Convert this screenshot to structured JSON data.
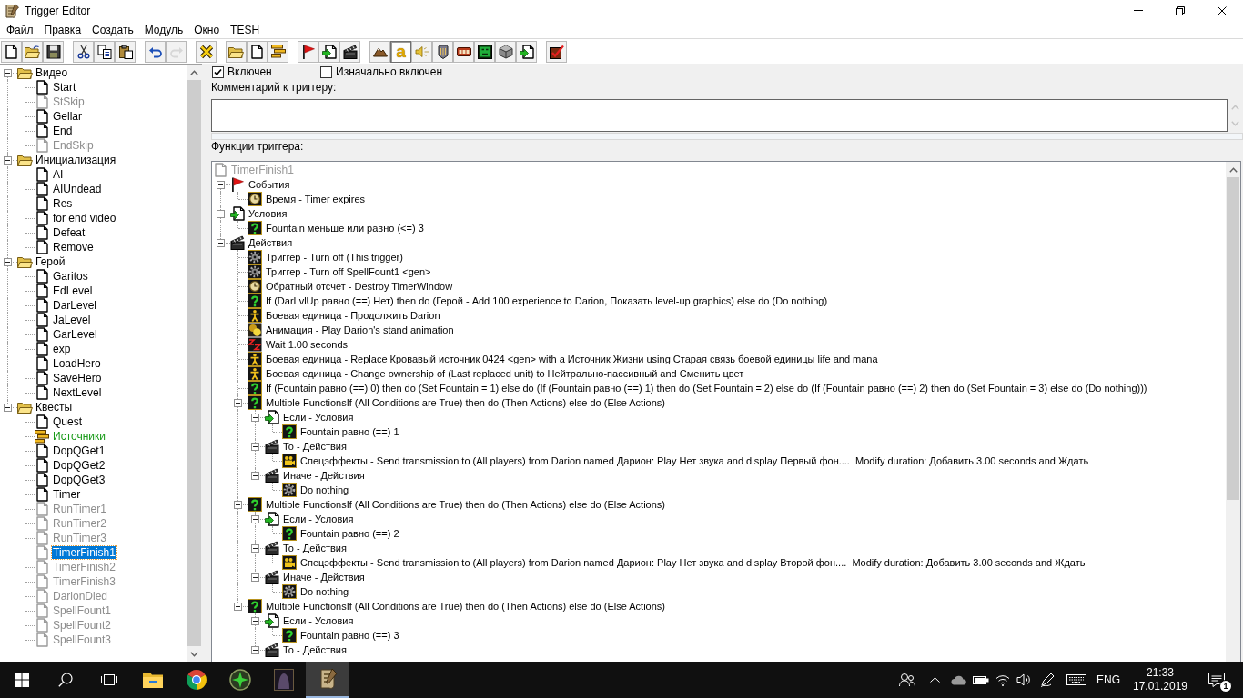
{
  "window": {
    "title": "Trigger Editor"
  },
  "menu": [
    "Файл",
    "Правка",
    "Создать",
    "Модуль",
    "Окно",
    "TESH"
  ],
  "toolbar": [
    {
      "buttons": [
        {
          "kind": "new",
          "disabled": false,
          "pressed": false
        },
        {
          "kind": "open",
          "disabled": false,
          "pressed": false
        },
        {
          "kind": "save",
          "disabled": false,
          "pressed": false
        }
      ]
    },
    {
      "buttons": [
        {
          "kind": "cut",
          "disabled": false,
          "pressed": false
        },
        {
          "kind": "copy",
          "disabled": false,
          "pressed": false
        },
        {
          "kind": "paste",
          "disabled": false,
          "pressed": false
        }
      ]
    },
    {
      "buttons": [
        {
          "kind": "undo",
          "disabled": false,
          "pressed": false
        },
        {
          "kind": "redo",
          "disabled": true,
          "pressed": false
        }
      ]
    },
    {
      "buttons": [
        {
          "kind": "cross",
          "disabled": false,
          "pressed": false
        }
      ]
    },
    {
      "buttons": [
        {
          "kind": "folder",
          "disabled": false,
          "pressed": false
        },
        {
          "kind": "document",
          "disabled": false,
          "pressed": false
        },
        {
          "kind": "lines",
          "disabled": false,
          "pressed": false
        }
      ]
    },
    {
      "buttons": [
        {
          "kind": "flag",
          "disabled": false,
          "pressed": false
        },
        {
          "kind": "arrow-document",
          "disabled": false,
          "pressed": false
        },
        {
          "kind": "clapperboard",
          "disabled": false,
          "pressed": false
        }
      ]
    },
    {
      "buttons": [
        {
          "kind": "mountain",
          "disabled": false,
          "pressed": false
        },
        {
          "kind": "letter",
          "label": "a",
          "disabled": false,
          "pressed": true
        },
        {
          "kind": "speaker",
          "disabled": false,
          "pressed": false
        },
        {
          "kind": "shield",
          "disabled": false,
          "pressed": false
        },
        {
          "kind": "panel",
          "disabled": false,
          "pressed": false
        },
        {
          "kind": "tile",
          "disabled": false,
          "pressed": false
        },
        {
          "kind": "cube",
          "disabled": false,
          "pressed": false
        },
        {
          "kind": "arrow-document",
          "disabled": false,
          "pressed": false
        }
      ]
    },
    {
      "buttons": [
        {
          "kind": "check",
          "disabled": false,
          "pressed": false
        }
      ]
    }
  ],
  "trigger_list": {
    "items": [
      {
        "label": "Видео",
        "kind": "folder",
        "expanded": true,
        "selected": false,
        "children": [
          {
            "label": "Start",
            "kind": "trigger",
            "enabled": true,
            "selected": false
          },
          {
            "label": "StSkip",
            "kind": "trigger",
            "enabled": false,
            "selected": false
          },
          {
            "label": "Gellar",
            "kind": "trigger",
            "enabled": true,
            "selected": false
          },
          {
            "label": "End",
            "kind": "trigger",
            "enabled": true,
            "selected": false
          },
          {
            "label": "EndSkip",
            "kind": "trigger",
            "enabled": false,
            "selected": false
          }
        ]
      },
      {
        "label": "Инициализация",
        "kind": "folder",
        "expanded": true,
        "selected": false,
        "children": [
          {
            "label": "AI",
            "kind": "trigger",
            "enabled": true,
            "selected": false
          },
          {
            "label": "AIUndead",
            "kind": "trigger",
            "enabled": true,
            "selected": false
          },
          {
            "label": "Res",
            "kind": "trigger",
            "enabled": true,
            "selected": false
          },
          {
            "label": "for end video",
            "kind": "trigger",
            "enabled": true,
            "selected": false
          },
          {
            "label": "Defeat",
            "kind": "trigger",
            "enabled": true,
            "selected": false
          },
          {
            "label": "Remove",
            "kind": "trigger",
            "enabled": true,
            "selected": false
          }
        ]
      },
      {
        "label": "Герой",
        "kind": "folder",
        "expanded": true,
        "selected": false,
        "children": [
          {
            "label": "Garitos",
            "kind": "trigger",
            "enabled": true,
            "selected": false
          },
          {
            "label": "EdLevel",
            "kind": "trigger",
            "enabled": true,
            "selected": false
          },
          {
            "label": "DarLevel",
            "kind": "trigger",
            "enabled": true,
            "selected": false
          },
          {
            "label": "JaLevel",
            "kind": "trigger",
            "enabled": true,
            "selected": false
          },
          {
            "label": "GarLevel",
            "kind": "trigger",
            "enabled": true,
            "selected": false
          },
          {
            "label": "exp",
            "kind": "trigger",
            "enabled": true,
            "selected": false
          },
          {
            "label": "LoadHero",
            "kind": "trigger",
            "enabled": true,
            "selected": false
          },
          {
            "label": "SaveHero",
            "kind": "trigger",
            "enabled": true,
            "selected": false
          },
          {
            "label": "NextLevel",
            "kind": "trigger",
            "enabled": true,
            "selected": false
          }
        ]
      },
      {
        "label": "Квесты",
        "kind": "folder",
        "expanded": true,
        "selected": false,
        "children": [
          {
            "label": "Quest",
            "kind": "trigger",
            "enabled": true,
            "selected": false
          },
          {
            "label": "Источники",
            "kind": "comment",
            "enabled": true,
            "selected": false
          },
          {
            "label": "DopQGet1",
            "kind": "trigger",
            "enabled": true,
            "selected": false
          },
          {
            "label": "DopQGet2",
            "kind": "trigger",
            "enabled": true,
            "selected": false
          },
          {
            "label": "DopQGet3",
            "kind": "trigger",
            "enabled": true,
            "selected": false
          },
          {
            "label": "Timer",
            "kind": "trigger",
            "enabled": true,
            "selected": false
          },
          {
            "label": "RunTimer1",
            "kind": "trigger",
            "enabled": false,
            "selected": false
          },
          {
            "label": "RunTimer2",
            "kind": "trigger",
            "enabled": false,
            "selected": false
          },
          {
            "label": "RunTimer3",
            "kind": "trigger",
            "enabled": false,
            "selected": false
          },
          {
            "label": "TimerFinish1",
            "kind": "trigger",
            "enabled": false,
            "selected": true
          },
          {
            "label": "TimerFinish2",
            "kind": "trigger",
            "enabled": false,
            "selected": false
          },
          {
            "label": "TimerFinish3",
            "kind": "trigger",
            "enabled": false,
            "selected": false
          },
          {
            "label": "DarionDied",
            "kind": "trigger",
            "enabled": false,
            "selected": false
          },
          {
            "label": "SpellFount1",
            "kind": "trigger",
            "enabled": false,
            "selected": false
          },
          {
            "label": "SpellFount2",
            "kind": "trigger",
            "enabled": false,
            "selected": false
          },
          {
            "label": "SpellFount3",
            "kind": "trigger",
            "enabled": false,
            "selected": false
          }
        ]
      }
    ]
  },
  "trigger": {
    "checkboxes": [
      {
        "label": "Включен",
        "checked": true
      },
      {
        "label": "Изначально включен",
        "checked": false
      }
    ],
    "comment": {
      "label": "Комментарий к триггеру:"
    },
    "functions": {
      "label": "Функции триггера:",
      "tree": {
        "label": "TimerFinish1",
        "enabled": false,
        "children": [
          {
            "label": "События",
            "kind": "events",
            "expanded": true,
            "children": [
              {
                "label": "Время - Timer expires",
                "kind": "timer"
              }
            ]
          },
          {
            "label": "Условия",
            "kind": "conditions",
            "expanded": true,
            "children": [
              {
                "label": "Fountain меньше или равно (<=) 3",
                "kind": "condition"
              }
            ]
          },
          {
            "label": "Действия",
            "kind": "actions",
            "expanded": true,
            "children": [
              {
                "label": "Триггер - Turn off (This trigger)",
                "kind": "trigger"
              },
              {
                "label": "Триггер - Turn off SpellFount1 <gen>",
                "kind": "trigger"
              },
              {
                "label": "Обратный отсчет - Destroy TimerWindow",
                "kind": "timer"
              },
              {
                "label": "If (DarLvlUp равно (==) Нет) then do (Герой - Add 100 experience to Darion, Показать level-up graphics) else do (Do nothing)",
                "kind": "logic"
              },
              {
                "label": "Боевая единица - Продолжить Darion",
                "kind": "unit"
              },
              {
                "label": "Анимация - Play Darion's stand animation",
                "kind": "animation"
              },
              {
                "label": "Wait 1.00 seconds",
                "kind": "wait"
              },
              {
                "label": "Боевая единица - Replace Кровавый источник 0424 <gen> with a Источник Жизни using Старая связь боевой единицы life and mana",
                "kind": "unit"
              },
              {
                "label": "Боевая единица - Change ownership of (Last replaced unit) to Нейтрально-пассивный and Сменить цвет",
                "kind": "unit"
              },
              {
                "label": "If (Fountain равно (==) 0) then do (Set Fountain = 1) else do (If (Fountain равно (==) 1) then do (Set Fountain = 2) else do (If (Fountain равно (==) 2) then do (Set Fountain = 3) else do (Do nothing)))",
                "kind": "logic"
              },
              {
                "label": "Multiple FunctionsIf (All Conditions are True) then do (Then Actions) else do (Else Actions)",
                "kind": "logic",
                "expanded": true,
                "children": [
                  {
                    "label": "Если - Условия",
                    "kind": "conditions",
                    "expanded": true,
                    "children": [
                      {
                        "label": "Fountain равно (==) 1",
                        "kind": "condition"
                      }
                    ]
                  },
                  {
                    "label": "То - Действия",
                    "kind": "actions",
                    "expanded": true,
                    "children": [
                      {
                        "label": "Спецэффекты - Send transmission to (All players) from Darion named Дарион: Play Нет звука and display Первый фон....  Modify duration: Добавить 3.00 seconds and Ждать",
                        "kind": "cinematic"
                      }
                    ]
                  },
                  {
                    "label": "Иначе - Действия",
                    "kind": "actions",
                    "expanded": true,
                    "children": [
                      {
                        "label": "Do nothing",
                        "kind": "general"
                      }
                    ]
                  }
                ]
              },
              {
                "label": "Multiple FunctionsIf (All Conditions are True) then do (Then Actions) else do (Else Actions)",
                "kind": "logic",
                "expanded": true,
                "children": [
                  {
                    "label": "Если - Условия",
                    "kind": "conditions",
                    "expanded": true,
                    "children": [
                      {
                        "label": "Fountain равно (==) 2",
                        "kind": "condition"
                      }
                    ]
                  },
                  {
                    "label": "То - Действия",
                    "kind": "actions",
                    "expanded": true,
                    "children": [
                      {
                        "label": "Спецэффекты - Send transmission to (All players) from Darion named Дарион: Play Нет звука and display Второй фон....  Modify duration: Добавить 3.00 seconds and Ждать",
                        "kind": "cinematic"
                      }
                    ]
                  },
                  {
                    "label": "Иначе - Действия",
                    "kind": "actions",
                    "expanded": true,
                    "children": [
                      {
                        "label": "Do nothing",
                        "kind": "general"
                      }
                    ]
                  }
                ]
              },
              {
                "label": "Multiple FunctionsIf (All Conditions are True) then do (Then Actions) else do (Else Actions)",
                "kind": "logic",
                "expanded": true,
                "children": [
                  {
                    "label": "Если - Условия",
                    "kind": "conditions",
                    "expanded": true,
                    "children": [
                      {
                        "label": "Fountain равно (==) 3",
                        "kind": "condition"
                      }
                    ]
                  },
                  {
                    "label": "То - Действия",
                    "kind": "actions",
                    "expanded": true
                  }
                ]
              }
            ]
          }
        ]
      }
    }
  },
  "taskbar": {
    "apps": [
      {
        "kind": "folder",
        "active": false
      },
      {
        "kind": "segmented-circle",
        "active": false
      },
      {
        "kind": "star-circle",
        "active": false
      },
      {
        "kind": "dark-tile",
        "active": false
      },
      {
        "kind": "scroll",
        "active": true
      }
    ],
    "language": "ENG",
    "time": "21:33",
    "date": "17.01.2019",
    "notifications": "1"
  }
}
